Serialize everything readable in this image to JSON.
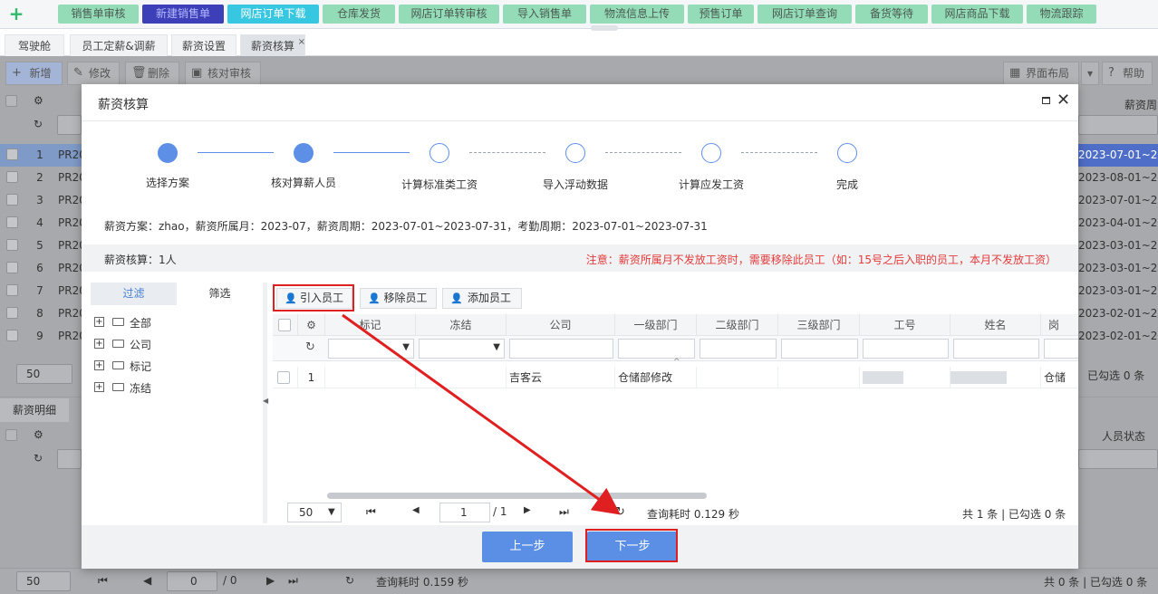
{
  "topnav": {
    "items": [
      {
        "label": "销售单审核"
      },
      {
        "label": "新建销售单"
      },
      {
        "label": "网店订单下载"
      },
      {
        "label": "仓库发货"
      },
      {
        "label": "网店订单转审核"
      },
      {
        "label": "导入销售单"
      },
      {
        "label": "物流信息上传"
      },
      {
        "label": "预售订单"
      },
      {
        "label": "网店订单查询"
      },
      {
        "label": "备货等待"
      },
      {
        "label": "网店商品下载"
      },
      {
        "label": "物流跟踪"
      }
    ]
  },
  "tabs": [
    {
      "label": "驾驶舱"
    },
    {
      "label": "员工定薪&调薪"
    },
    {
      "label": "薪资设置"
    },
    {
      "label": "薪资核算",
      "close": "×"
    }
  ],
  "background": {
    "toolbar": {
      "add": "新增",
      "edit": "修改",
      "delete": "删除",
      "verify": "核对审核",
      "layout": "界面布局",
      "help": "帮助"
    },
    "header_right": "薪资周",
    "rows": [
      {
        "num": "1",
        "code": "PR20",
        "date": "2023-07-01~20"
      },
      {
        "num": "2",
        "code": "PR20",
        "date": "2023-08-01~20"
      },
      {
        "num": "3",
        "code": "PR20",
        "date": "2023-07-01~20"
      },
      {
        "num": "4",
        "code": "PR20",
        "date": "2023-04-01~20"
      },
      {
        "num": "5",
        "code": "PR20",
        "date": "2023-03-01~20"
      },
      {
        "num": "6",
        "code": "PR20",
        "date": "2023-03-01~20"
      },
      {
        "num": "7",
        "code": "PR20",
        "date": "2023-03-01~20"
      },
      {
        "num": "8",
        "code": "PR20",
        "date": "2023-02-01~20"
      },
      {
        "num": "9",
        "code": "PR20",
        "date": "2023-02-01~20"
      }
    ],
    "pager1": {
      "size": "50",
      "summary": "已勾选 0 条"
    },
    "detail_tab": "薪资明细",
    "detail_col": "人员状态",
    "pager2": {
      "size": "50",
      "page": "0",
      "total": "/ 0",
      "time": "查询耗时 0.159 秒",
      "summary": "共 0 条 | 已勾选 0 条"
    }
  },
  "modal": {
    "title": "薪资核算",
    "close": "✕",
    "steps": [
      {
        "label": "选择方案"
      },
      {
        "label": "核对算薪人员"
      },
      {
        "label": "计算标准类工资"
      },
      {
        "label": "导入浮动数据"
      },
      {
        "label": "计算应发工资"
      },
      {
        "label": "完成"
      }
    ],
    "plan_info": "薪资方案：zhao，薪资所属月：2023-07，薪资周期：2023-07-01~2023-07-31，考勤周期：2023-07-01~2023-07-31",
    "count": "薪资核算：1人",
    "note": "注意：薪资所属月不发放工资时，需要移除此员工（如：15号之后入职的员工，本月不发放工资）",
    "left_tabs": {
      "filter": "过滤",
      "screen": "筛选"
    },
    "tree": [
      {
        "label": "全部"
      },
      {
        "label": "公司"
      },
      {
        "label": "标记"
      },
      {
        "label": "冻结"
      }
    ],
    "actions": {
      "import": "引入员工",
      "remove": "移除员工",
      "add": "添加员工"
    },
    "columns": {
      "mark": "标记",
      "freeze": "冻结",
      "company": "公司",
      "dept1": "一级部门",
      "dept2": "二级部门",
      "dept3": "三级部门",
      "empno": "工号",
      "name": "姓名",
      "post": "岗"
    },
    "row": {
      "num": "1",
      "company": "吉客云",
      "dept1": "仓储部修改",
      "post": "仓储"
    },
    "pager": {
      "size": "50",
      "page": "1",
      "total": "/ 1",
      "time": "查询耗时 0.129 秒",
      "summary": "共 1 条 | 已勾选 0 条"
    },
    "buttons": {
      "prev": "上一步",
      "next": "下一步"
    }
  },
  "colors": {
    "accent": "#5b8fe5",
    "highlight": "#e02020",
    "nav_green": "#93dcb7",
    "nav_active": "#3c3fb7"
  }
}
